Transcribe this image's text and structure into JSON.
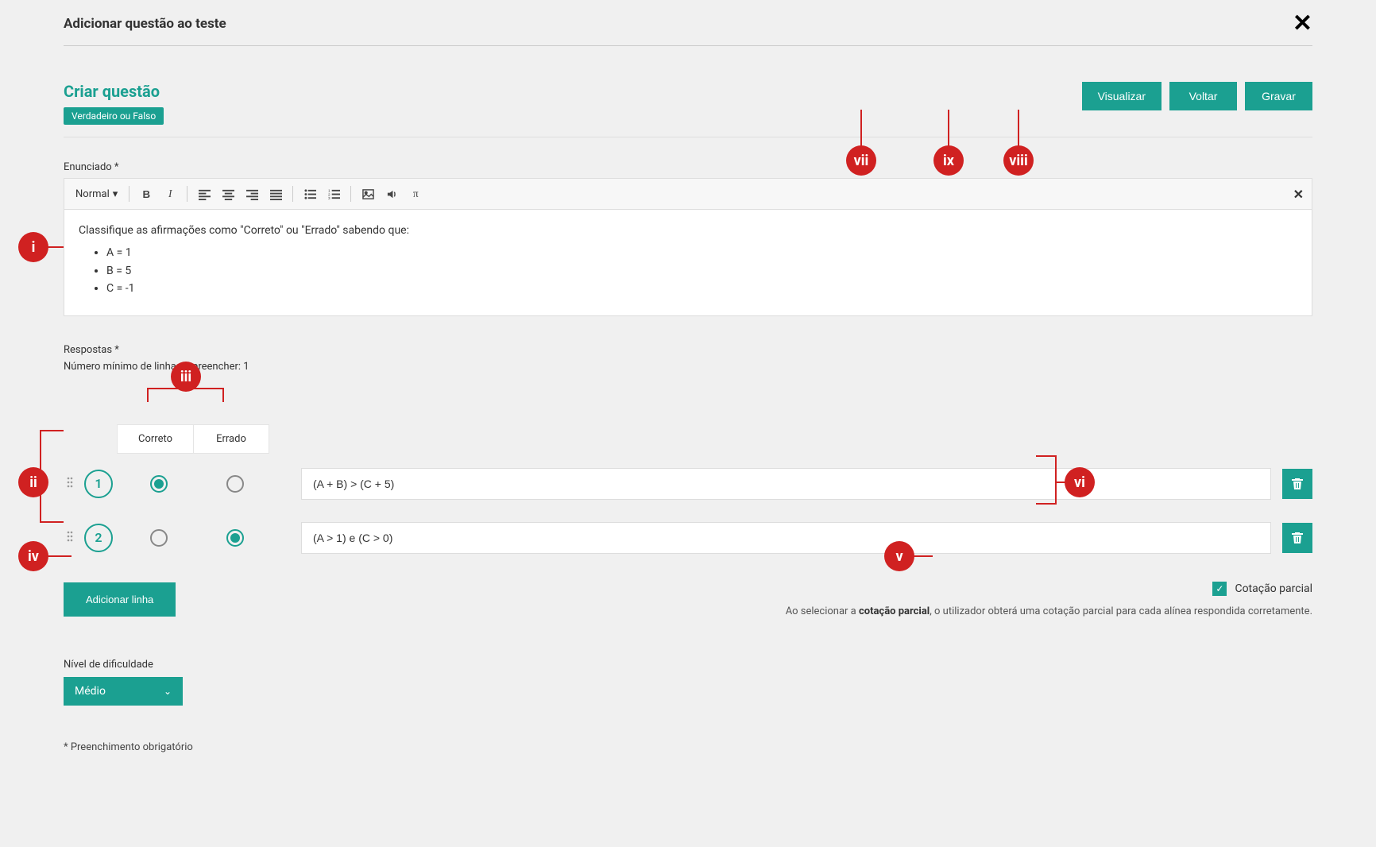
{
  "header": {
    "title": "Adicionar questão ao teste"
  },
  "page_title": "Criar questão",
  "question_type_badge": "Verdadeiro ou Falso",
  "buttons": {
    "preview": "Visualizar",
    "back": "Voltar",
    "save": "Gravar",
    "add_line": "Adicionar linha"
  },
  "editor": {
    "label": "Enunciado *",
    "toolbar_format": "Normal",
    "body_intro": "Classifique as afirmações como \"Correto\" ou \"Errado\" sabendo que:",
    "body_items": [
      "A = 1",
      "B = 5",
      "C = -1"
    ]
  },
  "answers": {
    "label": "Respostas *",
    "min_lines": "Número mínimo de linhas a preencher: 1",
    "col1": "Correto",
    "col2": "Errado",
    "rows": [
      {
        "num": "1",
        "text": "(A + B) > (C + 5)",
        "correct": true
      },
      {
        "num": "2",
        "text": "(A > 1) e (C > 0)",
        "correct": false
      }
    ]
  },
  "partial": {
    "label": "Cotação parcial",
    "desc_prefix": "Ao selecionar a ",
    "desc_bold": "cotação parcial",
    "desc_suffix": ", o utilizador obterá uma cotação parcial para cada alínea respondida corretamente."
  },
  "difficulty": {
    "label": "Nível de dificuldade",
    "value": "Médio"
  },
  "footnote": "* Preenchimento obrigatório",
  "callouts": [
    "i",
    "ii",
    "iii",
    "iv",
    "v",
    "vi",
    "vii",
    "viii",
    "ix"
  ]
}
